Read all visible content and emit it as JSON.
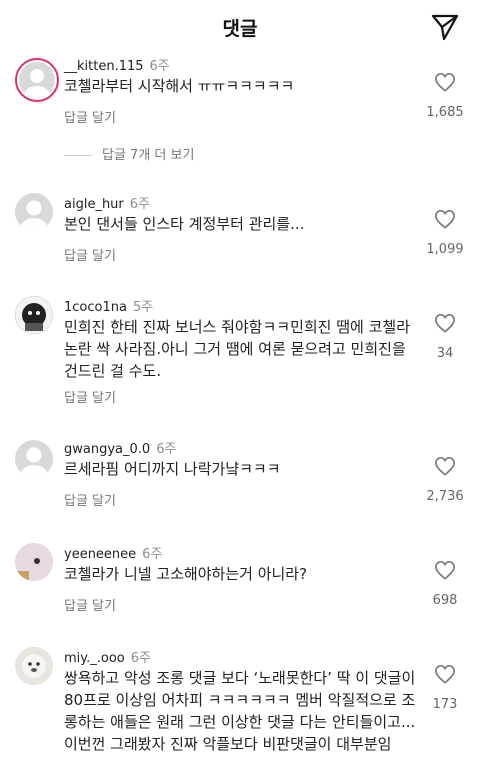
{
  "header": {
    "title": "댓글"
  },
  "comments": [
    {
      "user": "__kitten.115",
      "time": "6주",
      "text": "코첼라부터 시작해서 ㅠㅠㅋㅋㅋㅋㅋ",
      "reply": "답글 달기",
      "likes": "1,685"
    },
    {
      "user": "aigle_hur",
      "time": "6주",
      "text": "본인 댄서들 인스타 계정부터 관리를...",
      "reply": "답글 달기",
      "likes": "1,099"
    },
    {
      "user": "1coco1na",
      "time": "5주",
      "text": "민희진 한테 진짜 보너스 줘야함ㅋㅋ민희진 땜에 코첼라 논란 싹 사라짐.아니 그거 땜에 여론 묻으려고 민희진을 건드린 걸 수도.",
      "reply": "답글 달기",
      "likes": "34"
    },
    {
      "user": "gwangya_0.0",
      "time": "6주",
      "text": "르세라핌 어디까지 나락가냨ㅋㅋㅋ",
      "reply": "답글 달기",
      "likes": "2,736"
    },
    {
      "user": "yeeneenee",
      "time": "6주",
      "text": "코첼라가 니넬 고소해야하는거 아니라?",
      "reply": "답글 달기",
      "likes": "698"
    },
    {
      "user": "miy._.ooo",
      "time": "6주",
      "text": "쌍욕하고 악성 조롱 댓글 보다 ‘노래못한다’ 딱 이 댓글이 80프로 이상임 어차피 ㅋㅋㅋㅋㅋㅋ 멤버 악질적으로 조롱하는 애들은 원래 그런 이상한 댓글 다는 안티들이고...이번껀 그래봤자 진짜 악플보다 비판댓글이 대부분임",
      "likes": "173"
    }
  ],
  "more_replies": "답글 7개 더 보기"
}
